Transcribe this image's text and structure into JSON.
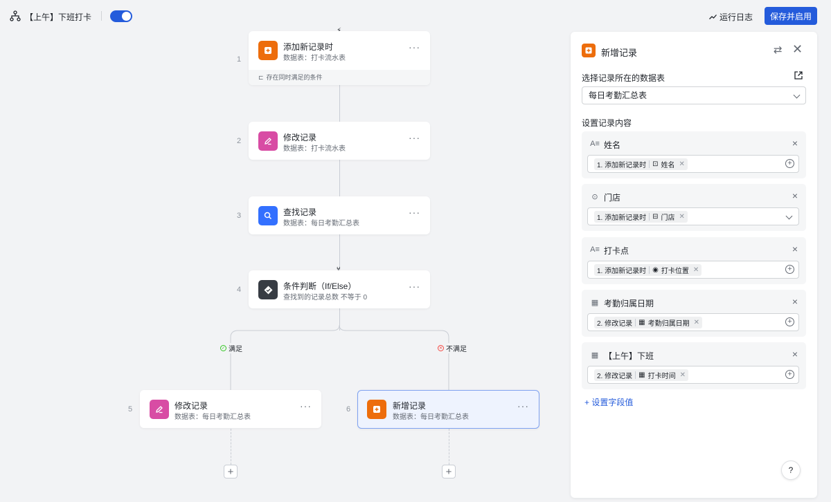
{
  "header": {
    "flow_icon": "workflow-icon",
    "flow_name": "【上午】下班打卡",
    "toggle_on": true,
    "run_log_label": "运行日志",
    "save_label": "保存并启用",
    "accent": "#245bdb"
  },
  "canvas": {
    "trigger_icon": "bolt-icon",
    "nodes": [
      {
        "num": "1",
        "title": "添加新记录时",
        "sub": "数据表：打卡流水表",
        "icon": "add-record-icon",
        "color": "#ed6d0c",
        "footer": "存在同时满足的条件"
      },
      {
        "num": "2",
        "title": "修改记录",
        "sub": "数据表：打卡流水表",
        "icon": "edit-icon",
        "color": "#d84ca4"
      },
      {
        "num": "3",
        "title": "查找记录",
        "sub": "数据表：每日考勤汇总表",
        "icon": "search-icon",
        "color": "#3370ff"
      },
      {
        "num": "4",
        "title": "条件判断（If/Else）",
        "sub": "查找到的记录总数 不等于 0",
        "icon": "condition-icon",
        "color": "#373c43"
      },
      {
        "num": "5",
        "title": "修改记录",
        "sub": "数据表：每日考勤汇总表",
        "icon": "edit-icon",
        "color": "#d84ca4"
      },
      {
        "num": "6",
        "title": "新增记录",
        "sub": "数据表：每日考勤汇总表",
        "icon": "add-record-icon",
        "color": "#ed6d0c"
      }
    ],
    "branch_yes": "满足",
    "branch_no": "不满足",
    "more_glyph": "···",
    "plus_glyph": "+"
  },
  "panel": {
    "title": "新增记录",
    "table_label": "选择记录所在的数据表",
    "table_value": "每日考勤汇总表",
    "content_label": "设置记录内容",
    "fields": [
      {
        "type_icon": "text-field-icon",
        "name": "姓名",
        "step": "1. 添加新记录时",
        "ref_icon": "person-field-icon",
        "ref": "姓名",
        "control": "add"
      },
      {
        "type_icon": "single-select-icon",
        "name": "门店",
        "step": "1. 添加新记录时",
        "ref_icon": "lookup-field-icon",
        "ref": "门店",
        "control": "dropdown"
      },
      {
        "type_icon": "text-field-icon",
        "name": "打卡点",
        "step": "1. 添加新记录时",
        "ref_icon": "location-icon",
        "ref": "打卡位置",
        "control": "add"
      },
      {
        "type_icon": "date-field-icon",
        "name": "考勤归属日期",
        "step": "2. 修改记录",
        "ref_icon": "date-field-icon",
        "ref": "考勤归属日期",
        "control": "add"
      },
      {
        "type_icon": "date-field-icon",
        "name": "【上午】下班",
        "step": "2. 修改记录",
        "ref_icon": "date-field-icon",
        "ref": "打卡时间",
        "control": "add"
      }
    ],
    "add_field_label": "+ 设置字段值",
    "help_glyph": "?"
  }
}
